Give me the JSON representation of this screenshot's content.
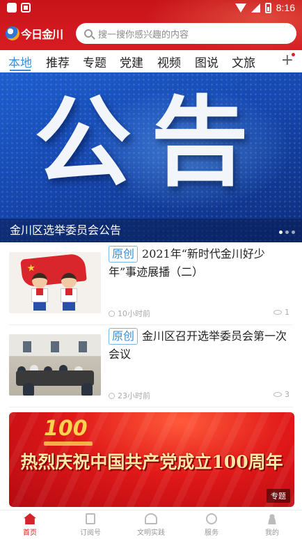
{
  "status_bar": {
    "time": "8:16"
  },
  "header": {
    "logo_text": "今日金川",
    "search_placeholder": "搜一搜你感兴趣的内容"
  },
  "tabs": [
    "本地",
    "推荐",
    "专题",
    "党建",
    "视频",
    "图说",
    "文旅"
  ],
  "tabs_add_label": "+",
  "banner": {
    "big_text": "公告",
    "caption": "金川区选举委员会公告"
  },
  "news": [
    {
      "tag": "原创",
      "title": "2021年“新时代金川好少年”事迹展播（二）",
      "time": "10小时前",
      "views": "1"
    },
    {
      "tag": "原创",
      "title": "金川区召开选举委员会第一次会议",
      "time": "23小时前",
      "views": "3"
    }
  ],
  "promo": {
    "emblem_number": "100",
    "text": "热烈庆祝中国共产党成立100周年",
    "tag": "专题"
  },
  "bottom_nav": [
    "首页",
    "订阅号",
    "文明实践",
    "服务",
    "我的"
  ],
  "colors": {
    "header_red": "#d71c22",
    "tab_active": "#3a8fd8",
    "nav_active": "#d5232a"
  }
}
